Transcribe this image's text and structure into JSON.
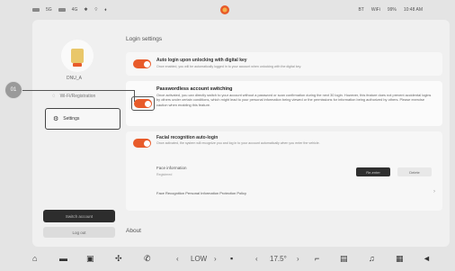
{
  "status_bar": {
    "left_items": [
      "5G",
      "4G"
    ],
    "right_items": [
      "BT",
      "WiFi",
      "99%",
      "10:48 AM"
    ]
  },
  "sidebar": {
    "user_name": "DNU_A",
    "items": [
      {
        "label": "Wi-Fi/Registration"
      },
      {
        "label": "Settings"
      }
    ],
    "switch_account_label": "Switch account",
    "logout_label": "Log out"
  },
  "main": {
    "login_settings_title": "Login settings",
    "auto_login": {
      "title": "Auto login upon unlocking with digital key",
      "desc": "Once enabled, you will be automatically logged in to your account when unlocking with the digital key."
    },
    "passwordless": {
      "title": "Passwordless account switching",
      "desc": "Once activated, you can directly switch to your account without a password or scan confirmation during the next 30 login. However, this feature does not prevent accidental logins by others under certain conditions, which might lead to your personal information being viewed or the permissions for information being authorized by others. Please exercise caution when enabling this feature."
    },
    "face_login": {
      "title": "Facial recognition auto-login",
      "desc": "Once activated, the system will recognize you and log in to your account automatically when you enter the vehicle.",
      "face_info_label": "Face information",
      "face_info_hint": "Registered",
      "reenter_label": "Re-enter",
      "delete_label": "Delete",
      "policy_label": "Face Recognition Personal Information Protection Policy"
    },
    "about_title": "About"
  },
  "callout": {
    "number": "01"
  },
  "dock": {
    "items": [
      "home-icon",
      "car-icon",
      "phone-icon",
      "fan-icon",
      "seat-icon"
    ],
    "fan_label": "LOW",
    "temp_label": "17.5°",
    "right_items": [
      "seat-heat-icon",
      "grid-icon",
      "music-icon",
      "apps-icon",
      "volume-icon"
    ]
  },
  "colors": {
    "accent": "#e85b2a",
    "dark_button": "#2d2d2d"
  }
}
